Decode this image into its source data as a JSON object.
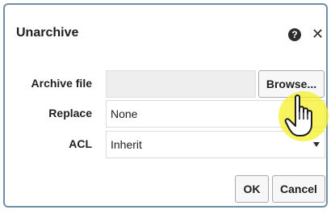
{
  "dialog": {
    "title": "Unarchive",
    "help_icon": "help-icon",
    "close_icon": "close-icon",
    "help_glyph": "?",
    "close_glyph": "✕"
  },
  "form": {
    "archive_file": {
      "label": "Archive file",
      "value": "",
      "browse_label": "Browse..."
    },
    "replace": {
      "label": "Replace",
      "value": "None"
    },
    "acl": {
      "label": "ACL",
      "value": "Inherit"
    }
  },
  "actions": {
    "ok_label": "OK",
    "cancel_label": "Cancel"
  },
  "cursor": {
    "icon": "hand-pointer-icon",
    "highlight_color": "#f5f028"
  },
  "colors": {
    "dialog_border": "#6f8fa8",
    "file_input_bg": "#eeeeee"
  }
}
